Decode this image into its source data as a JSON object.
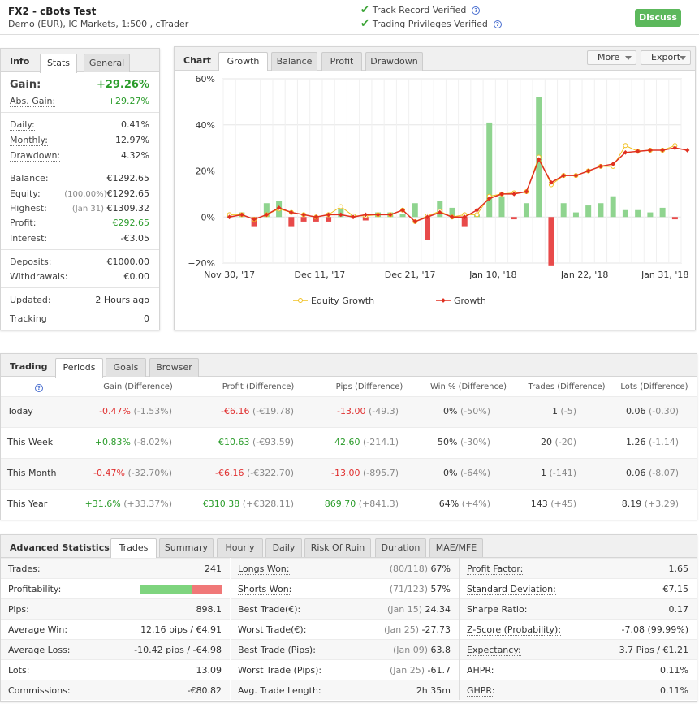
{
  "header": {
    "title": "FX2 - cBots Test",
    "account_type": "Demo (EUR),",
    "broker": "IC Markets",
    "leverage_platform": ", 1:500 , cTrader",
    "track_record": "Track Record Verified",
    "trading_privileges": "Trading Privileges Verified",
    "discuss_label": "Discuss"
  },
  "info": {
    "title": "Info",
    "tabs": [
      "Stats",
      "General"
    ],
    "gain_label": "Gain:",
    "gain_value": "+29.26%",
    "abs_gain_label": "Abs. Gain:",
    "abs_gain_value": "+29.27%",
    "daily_label": "Daily:",
    "daily_value": "0.41%",
    "monthly_label": "Monthly:",
    "monthly_value": "12.97%",
    "drawdown_label": "Drawdown:",
    "drawdown_value": "4.32%",
    "balance_label": "Balance:",
    "balance_value": "€1292.65",
    "equity_label": "Equity:",
    "equity_note": "(100.00%)",
    "equity_value": "€1292.65",
    "highest_label": "Highest:",
    "highest_note": "(Jan 31)",
    "highest_value": "€1309.32",
    "profit_label": "Profit:",
    "profit_value": "€292.65",
    "interest_label": "Interest:",
    "interest_value": "-€3.05",
    "deposits_label": "Deposits:",
    "deposits_value": "€1000.00",
    "withdrawals_label": "Withdrawals:",
    "withdrawals_value": "€0.00",
    "updated_label": "Updated:",
    "updated_value": "2 Hours ago",
    "tracking_label": "Tracking",
    "tracking_value": "0"
  },
  "chart_panel": {
    "title": "Chart",
    "tabs": [
      "Growth",
      "Balance",
      "Profit",
      "Drawdown"
    ],
    "more_label": "More",
    "export_label": "Export"
  },
  "chart_data": {
    "type": "bar",
    "ylim": [
      -20,
      60
    ],
    "yticks": [
      "60%",
      "40%",
      "20%",
      "0%",
      "−20%"
    ],
    "ytick_values": [
      60,
      40,
      20,
      0,
      -20
    ],
    "xticks": [
      "Nov 30, '17",
      "Dec 11, '17",
      "Dec 21, '17",
      "Jan 10, '18",
      "Jan 22, '18",
      "Jan 31, '18"
    ],
    "xtick_index": [
      0,
      7.3,
      14.6,
      21.3,
      28.7,
      35.2
    ],
    "bar_values": [
      0.5,
      2,
      -4,
      6,
      7,
      -4,
      -2,
      -2,
      -2,
      3.5,
      1,
      -1.5,
      2,
      2,
      1.5,
      6,
      -10,
      7,
      4,
      -4,
      1,
      41,
      9,
      -1,
      6,
      52,
      -21,
      6,
      2,
      5,
      6,
      9,
      3,
      3,
      2,
      4,
      -1
    ],
    "series": [
      {
        "name": "Equity Growth",
        "color": "#f0c020",
        "values": [
          1,
          1,
          -1,
          1,
          3.5,
          2,
          1,
          0,
          1,
          4.5,
          0.5,
          0.5,
          1,
          1,
          3,
          -2,
          0.5,
          2.5,
          0,
          1,
          1,
          9,
          10,
          10.5,
          11,
          26,
          14,
          18,
          18,
          20,
          22,
          22,
          31,
          28.5,
          29,
          29,
          31
        ]
      },
      {
        "name": "Growth",
        "color": "#e03020",
        "values": [
          0,
          1,
          -1,
          1,
          4,
          2,
          1,
          0,
          1,
          1,
          0,
          1,
          1,
          1,
          3,
          -2,
          0,
          2,
          0,
          0,
          3,
          8,
          10,
          10,
          11,
          25,
          15,
          18,
          18,
          20,
          22,
          23,
          28,
          28.5,
          29,
          29,
          30,
          29
        ]
      }
    ],
    "bar_color_pos": "#8fd48f",
    "bar_color_neg": "#e84a4a",
    "legend_position": "bottom",
    "grid": true
  },
  "trading": {
    "title": "Trading",
    "tabs": [
      "Periods",
      "Goals",
      "Browser"
    ],
    "columns": [
      "Gain (Difference)",
      "Profit (Difference)",
      "Pips (Difference)",
      "Win % (Difference)",
      "Trades (Difference)",
      "Lots (Difference)"
    ],
    "rows": [
      {
        "label": "Today",
        "gain": "-0.47%",
        "gain_d": "(-1.53%)",
        "profit": "-€6.16",
        "profit_d": "(-€19.78)",
        "pips": "-13.00",
        "pips_d": "(-49.3)",
        "win": "0%",
        "win_d": "(-50%)",
        "trades": "1",
        "trades_d": "(-5)",
        "lots": "0.06",
        "lots_d": "(-0.30)"
      },
      {
        "label": "This Week",
        "gain": "+0.83%",
        "gain_d": "(-8.02%)",
        "profit": "€10.63",
        "profit_d": "(-€93.59)",
        "pips": "42.60",
        "pips_d": "(-214.1)",
        "win": "50%",
        "win_d": "(-30%)",
        "trades": "20",
        "trades_d": "(-20)",
        "lots": "1.26",
        "lots_d": "(-1.14)"
      },
      {
        "label": "This Month",
        "gain": "-0.47%",
        "gain_d": "(-32.70%)",
        "profit": "-€6.16",
        "profit_d": "(-€322.70)",
        "pips": "-13.00",
        "pips_d": "(-895.7)",
        "win": "0%",
        "win_d": "(-64%)",
        "trades": "1",
        "trades_d": "(-141)",
        "lots": "0.06",
        "lots_d": "(-8.07)"
      },
      {
        "label": "This Year",
        "gain": "+31.6%",
        "gain_d": "(+33.37%)",
        "profit": "€310.38",
        "profit_d": "(+€328.11)",
        "pips": "869.70",
        "pips_d": "(+841.3)",
        "win": "64%",
        "win_d": "(+4%)",
        "trades": "143",
        "trades_d": "(+45)",
        "lots": "8.19",
        "lots_d": "(+3.29)"
      }
    ]
  },
  "advanced": {
    "title": "Advanced Statistics",
    "tabs": [
      "Trades",
      "Summary",
      "Hourly",
      "Daily",
      "Risk Of Ruin",
      "Duration",
      "MAE/MFE"
    ],
    "col1": [
      {
        "label": "Trades:",
        "value": "241"
      },
      {
        "label": "Profitability:",
        "value": ""
      },
      {
        "label": "Pips:",
        "value": "898.1"
      },
      {
        "label": "Average Win:",
        "value": "12.16 pips / €4.91"
      },
      {
        "label": "Average Loss:",
        "value": "-10.42 pips / -€4.98"
      },
      {
        "label": "Lots:",
        "value": "13.09"
      },
      {
        "label": "Commissions:",
        "value": "-€80.82"
      }
    ],
    "profitability_win_pct": 64,
    "col2": [
      {
        "label": "Longs Won:",
        "note": "(80/118)",
        "value": "67%"
      },
      {
        "label": "Shorts Won:",
        "note": "(71/123)",
        "value": "57%"
      },
      {
        "label": "Best Trade(€):",
        "note": "(Jan 15)",
        "value": "24.34"
      },
      {
        "label": "Worst Trade(€):",
        "note": "(Jan 25)",
        "value": "-27.73"
      },
      {
        "label": "Best Trade (Pips):",
        "note": "(Jan 09)",
        "value": "63.8"
      },
      {
        "label": "Worst Trade (Pips):",
        "note": "(Jan 25)",
        "value": "-61.7"
      },
      {
        "label": "Avg. Trade Length:",
        "note": "",
        "value": "2h 35m"
      }
    ],
    "col3": [
      {
        "label": "Profit Factor:",
        "value": "1.65"
      },
      {
        "label": "Standard Deviation:",
        "value": "€7.15"
      },
      {
        "label": "Sharpe Ratio:",
        "value": "0.17"
      },
      {
        "label": "Z-Score (Probability):",
        "value": "-7.08 (99.99%)"
      },
      {
        "label": "Expectancy:",
        "value": "3.7 Pips / €1.21"
      },
      {
        "label": "AHPR:",
        "value": "0.11%"
      },
      {
        "label": "GHPR:",
        "value": "0.11%"
      }
    ]
  }
}
